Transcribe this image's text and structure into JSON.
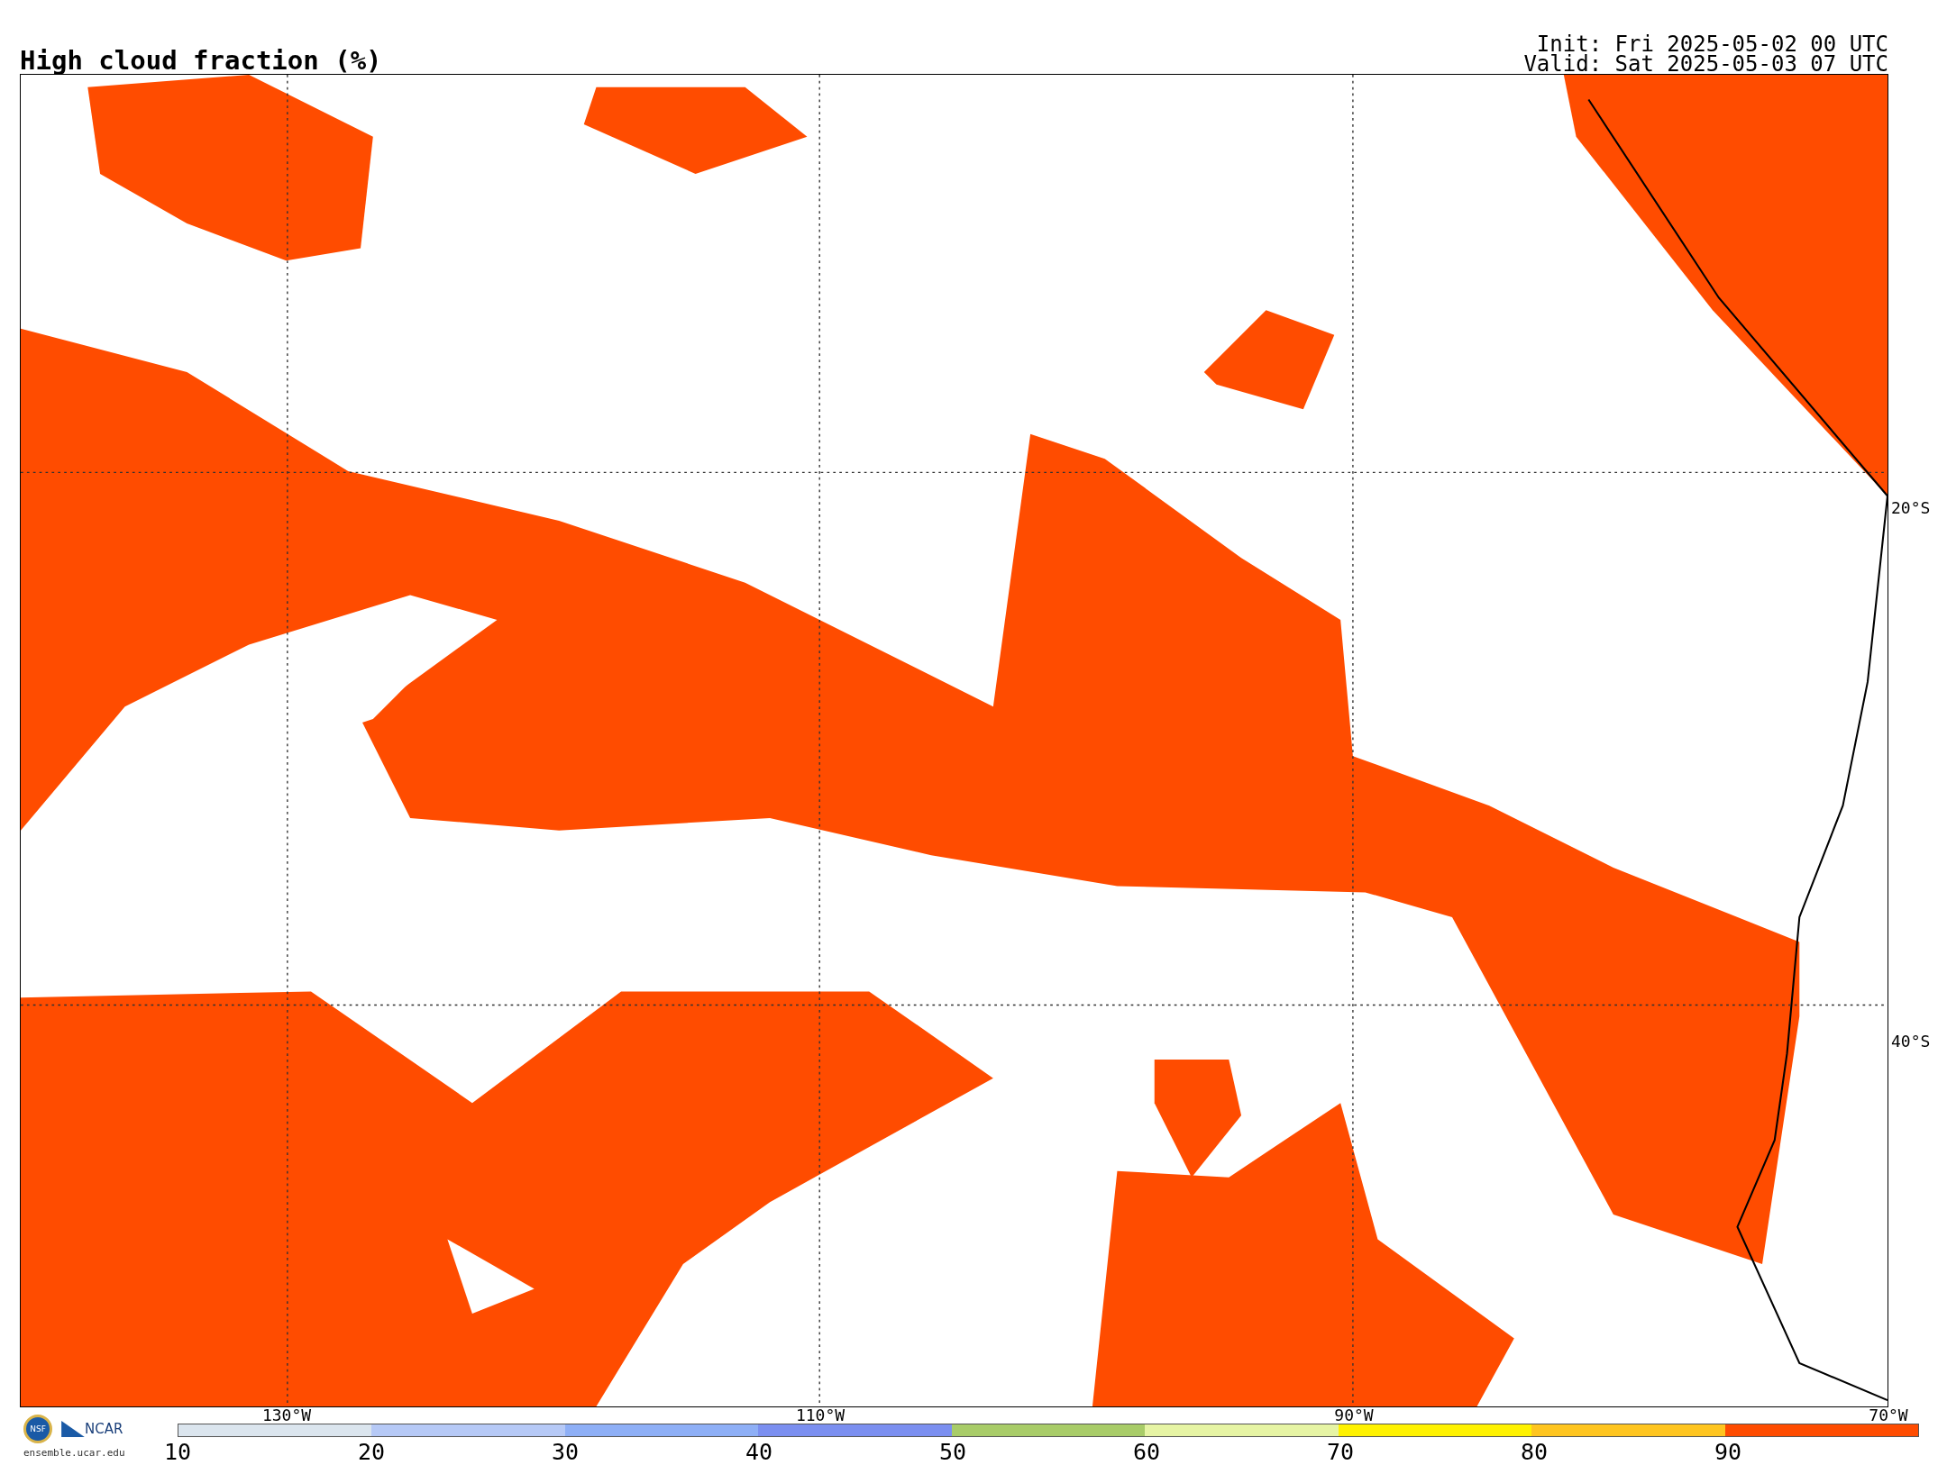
{
  "title": "High cloud fraction (%)",
  "init": "Init: Fri 2025-05-02 00 UTC",
  "valid": "Valid: Sat 2025-05-03 07 UTC",
  "map": {
    "lat_labels": [
      "20°S",
      "40°S"
    ],
    "lon_labels": [
      "130°W",
      "110°W",
      "90°W",
      "70°W"
    ]
  },
  "logos": {
    "nsf": "NSF",
    "ncar": "NCAR",
    "url": "ensemble.ucar.edu"
  },
  "colorbar": {
    "ticks": [
      "10",
      "20",
      "30",
      "40",
      "50",
      "60",
      "70",
      "80",
      "90"
    ],
    "bins": [
      {
        "color": "#dbe5ee"
      },
      {
        "color": "#b6c9f6"
      },
      {
        "color": "#8eaff6"
      },
      {
        "color": "#7b8ff0"
      },
      {
        "color": "#a8cc68"
      },
      {
        "color": "#e6f4a4"
      },
      {
        "color": "#fff200"
      },
      {
        "color": "#ffc51f"
      },
      {
        "color": "#ff4c00"
      }
    ]
  }
}
